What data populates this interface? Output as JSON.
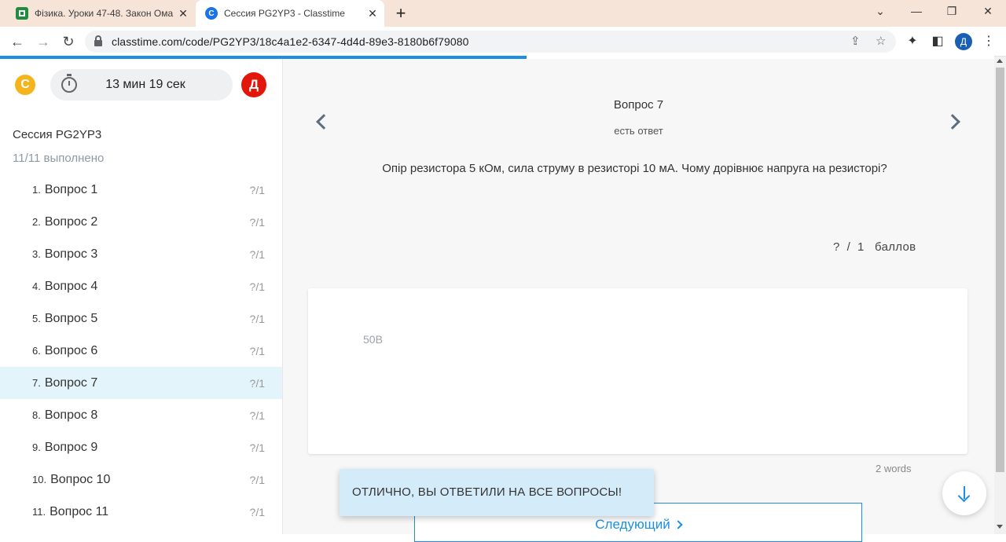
{
  "browser": {
    "tabs": [
      {
        "title": "Фізика. Уроки 47-48. Закон Ома",
        "close": "✕"
      },
      {
        "title": "Сессия PG2YP3 - Classtime",
        "close": "✕"
      }
    ],
    "new_tab": "+",
    "url": "classtime.com/code/PG2YP3/18c4a1e2-6347-4d4d-89e3-8180b6f79080",
    "profile_initial": "Д"
  },
  "sidebar": {
    "timer": "13 мин 19 сек",
    "avatar_initial": "Д",
    "session_title": "Сессия PG2YP3",
    "progress": "11/11 выполнено",
    "questions": [
      {
        "num": "1.",
        "label": "Вопрос 1",
        "score": "?/1"
      },
      {
        "num": "2.",
        "label": "Вопрос 2",
        "score": "?/1"
      },
      {
        "num": "3.",
        "label": "Вопрос 3",
        "score": "?/1"
      },
      {
        "num": "4.",
        "label": "Вопрос 4",
        "score": "?/1"
      },
      {
        "num": "5.",
        "label": "Вопрос 5",
        "score": "?/1"
      },
      {
        "num": "6.",
        "label": "Вопрос 6",
        "score": "?/1"
      },
      {
        "num": "7.",
        "label": "Вопрос 7",
        "score": "?/1"
      },
      {
        "num": "8.",
        "label": "Вопрос 8",
        "score": "?/1"
      },
      {
        "num": "9.",
        "label": "Вопрос 9",
        "score": "?/1"
      },
      {
        "num": "10.",
        "label": "Вопрос 10",
        "score": "?/1"
      },
      {
        "num": "11.",
        "label": "Вопрос 11",
        "score": "?/1"
      }
    ],
    "active_question": 7
  },
  "main": {
    "question_header": "Вопрос 7",
    "question_status": "есть ответ",
    "question_text": "Опір резистора 5 кОм, сила струму в резисторі 10 мА. Чому дорівнює напруга на резисторі?",
    "points": "?  /  1   баллов",
    "answer": "50В",
    "word_count": "2 words",
    "toast": "ОТЛИЧНО, ВЫ ОТВЕТИЛИ НА ВСЕ ВОПРОСЫ!",
    "next_label": "Следующий"
  },
  "page_progress": 0.53,
  "colors": {
    "accent": "#1a8fe3",
    "active_row": "#e4f4fb",
    "avatar": "#e3160b",
    "logo": "#f5b31c",
    "toast": "#d4ecfa"
  }
}
